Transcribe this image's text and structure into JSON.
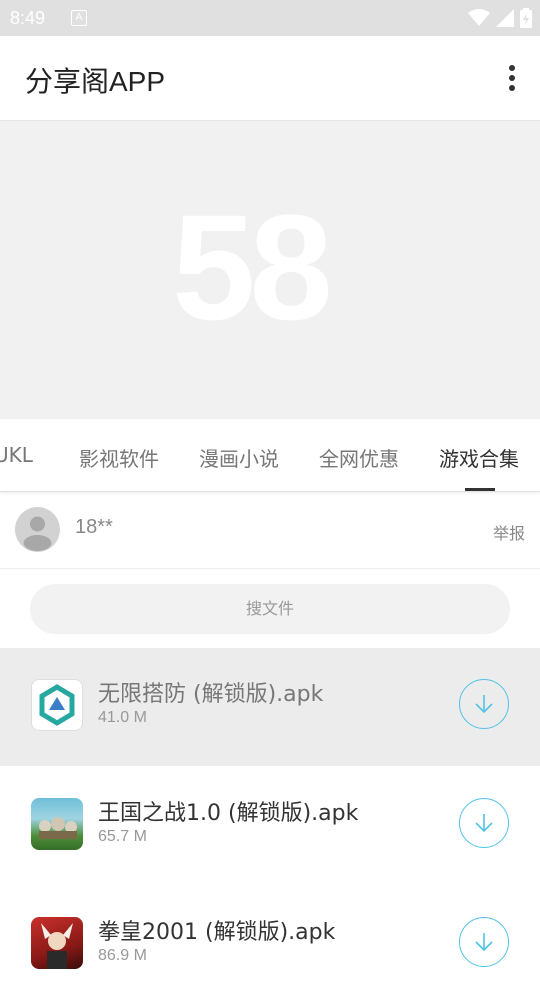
{
  "status_bar": {
    "time": "8:49",
    "notification_letter": "A"
  },
  "app_bar": {
    "title": "分享阁APP"
  },
  "banner": {
    "logo_text": "58"
  },
  "tabs": [
    {
      "label": "UKL"
    },
    {
      "label": "影视软件"
    },
    {
      "label": "漫画小说"
    },
    {
      "label": "全网优惠"
    },
    {
      "label": "游戏合集",
      "active": true
    }
  ],
  "user": {
    "name": "18**",
    "report_label": "举报"
  },
  "search": {
    "placeholder": "搜文件"
  },
  "files": [
    {
      "name": "无限搭防 (解锁版).apk",
      "size": "41.0 M",
      "icon": "tower-defense-app-icon"
    },
    {
      "name": "王国之战1.0 (解锁版).apk",
      "size": "65.7 M",
      "icon": "kingdom-war-app-icon"
    },
    {
      "name": "拳皇2001 (解锁版).apk",
      "size": "86.9 M",
      "icon": "kof-2001-app-icon"
    }
  ],
  "colors": {
    "accent": "#4fc3e8",
    "status_bar": "#e0e0e0",
    "banner": "#f1f1f1"
  }
}
